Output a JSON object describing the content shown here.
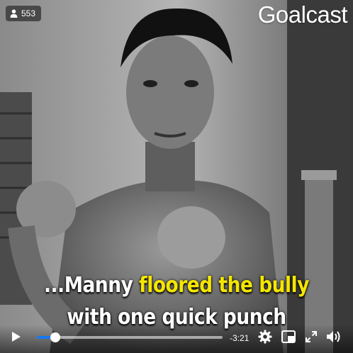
{
  "viewer_count": "553",
  "brand": "Goalcast",
  "caption": {
    "line1_white": "...Manny ",
    "line1_yellow": "floored the bully",
    "line2": "with one quick punch"
  },
  "controls": {
    "time_remaining": "-3:21",
    "progress": 0.1
  },
  "icons": {
    "viewer": "person-icon",
    "play": "play-icon",
    "settings": "gear-icon",
    "pip": "picture-in-picture-icon",
    "fullscreen": "expand-icon",
    "volume": "speaker-icon"
  },
  "colors": {
    "caption_highlight": "#f5e600",
    "progress_accent": "#1877f2"
  }
}
